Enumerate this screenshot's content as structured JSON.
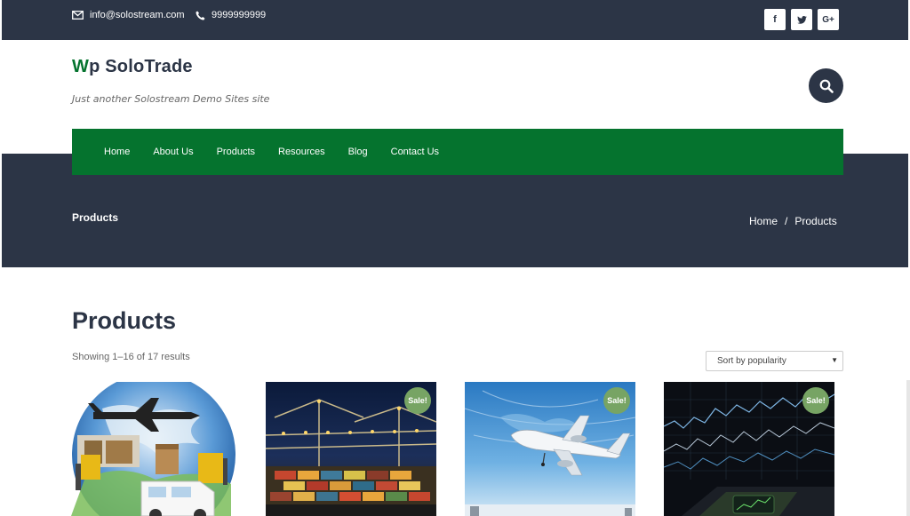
{
  "topbar": {
    "email": "info@solostream.com",
    "phone": "9999999999",
    "social": [
      "f",
      "t",
      "G+"
    ]
  },
  "header": {
    "title_initial": "W",
    "title_rest": "p SoloTrade",
    "tagline": "Just another Solostream Demo Sites site"
  },
  "nav": {
    "items": [
      {
        "label": "Home"
      },
      {
        "label": "About Us"
      },
      {
        "label": "Products"
      },
      {
        "label": "Resources"
      },
      {
        "label": "Blog"
      },
      {
        "label": "Contact Us"
      }
    ]
  },
  "band": {
    "title": "Products",
    "breadcrumb_home": "Home",
    "breadcrumb_sep": "/",
    "breadcrumb_current": "Products"
  },
  "main": {
    "heading": "Products",
    "result_count": "Showing 1–16 of 17 results",
    "sort_value": "Sort by popularity",
    "sale_label": "Sale!"
  },
  "icons": {
    "email": "envelope-icon",
    "phone": "phone-icon",
    "search": "search-icon",
    "facebook": "facebook-icon",
    "twitter": "twitter-icon",
    "google_plus": "google-plus-icon"
  },
  "colors": {
    "dark": "#2c3546",
    "green": "#05732e",
    "sale": "#77a464"
  }
}
